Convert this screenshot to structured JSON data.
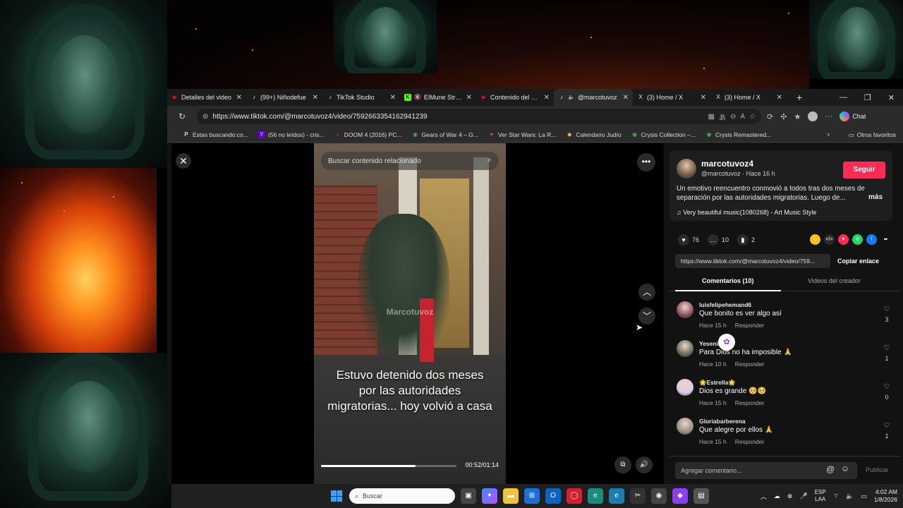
{
  "browser": {
    "tabs": [
      {
        "label": "Detalles del video",
        "icon": "youtube-icon",
        "color": "#ff0000",
        "active": false
      },
      {
        "label": "(99+) Niñodefue",
        "icon": "tiktok-icon",
        "color": "#ffffff",
        "active": false
      },
      {
        "label": "TikTok Studio",
        "icon": "tiktok-icon",
        "color": "#ffffff",
        "active": false
      },
      {
        "label": "ElMune Stream",
        "icon": "kick-icon",
        "color": "#53fc18",
        "active": false
      },
      {
        "label": "Contenido del cana",
        "icon": "youtube-icon",
        "color": "#ff0000",
        "active": false
      },
      {
        "label": "@marcotuvoz",
        "icon": "tiktok-icon",
        "color": "#ffffff",
        "active": true
      },
      {
        "label": "(3) Home / X",
        "icon": "x-icon",
        "color": "#ffffff",
        "active": false
      },
      {
        "label": "(3) Home / X",
        "icon": "x-icon",
        "color": "#ffffff",
        "active": false
      }
    ],
    "url": "https://www.tiktok.com/@marcotuvoz4/video/7592663354162941239",
    "chat_label": "Chat",
    "bookmarks": [
      {
        "label": "Estas buscando:co...",
        "icon": "P"
      },
      {
        "label": "(56 no leídos) - cris...",
        "icon": "Y"
      },
      {
        "label": "DOOM 4 (2016) PC...",
        "icon": "↓"
      },
      {
        "label": "Gears of War 4 – G...",
        "icon": "🎮"
      },
      {
        "label": "Ver Star Wars: La R...",
        "icon": "★"
      },
      {
        "label": "Calendario Judío",
        "icon": "◆"
      },
      {
        "label": "Crysis Collection –...",
        "icon": "🎮"
      },
      {
        "label": "Crysis Remastered...",
        "icon": "🎮"
      }
    ],
    "other_bookmarks": "Otros favoritos"
  },
  "video": {
    "search_placeholder": "Buscar contenido relacionado",
    "watermark": "Marcotuvoz",
    "caption": "Estuvo detenido dos meses por las autoridades migratorias... hoy volvió a casa",
    "time": "00:52/01:14",
    "progress": 0.7
  },
  "post": {
    "username": "marcotuvoz4",
    "handle": "@marcotuvoz · Hace 16 h",
    "follow_label": "Seguir",
    "description": "Un emotivo reencuentro conmovió a todos tras dos meses de separación por las autoridades migratorias. Luego de...",
    "more_label": "más",
    "music": "♫  Very beautiful music(1080268) - Art Music Style",
    "likes": "76",
    "comments": "10",
    "saves": "2",
    "link": "https://www.tiktok.com/@marcotuvoz4/video/759...",
    "copy_label": "Copiar enlace",
    "tab_comments": "Comentarios (10)",
    "tab_creator": "Videos del creador"
  },
  "comments": [
    {
      "user": "luisfelipehemand6",
      "text": "Que bonito es ver algo así",
      "time": "Hace 15 h",
      "reply": "Responder",
      "likes": "3",
      "avatar_color": "#8a4e5c"
    },
    {
      "user": "Yesenia sv",
      "text": "Para Dios no ha imposible 🙏",
      "time": "Hace 10 h",
      "reply": "Responder",
      "likes": "1",
      "avatar_color": "#6b6b5a"
    },
    {
      "user": "🌟Estrella🌟",
      "text": "Dios es grande 🥺🥺",
      "time": "Hace 15 h",
      "reply": "Responder",
      "likes": "0",
      "avatar_color": "#d9c9e6"
    },
    {
      "user": "Gloriabarberena",
      "text": "Que alegre por ellos 🙏",
      "time": "Hace 15 h",
      "reply": "Responder",
      "likes": "1",
      "avatar_color": "#9a8e86"
    }
  ],
  "add_comment": {
    "placeholder": "Agregar comentario...",
    "publish_label": "Publicar"
  },
  "taskbar": {
    "search_placeholder": "Buscar",
    "lang": "ESP",
    "lang2": "LAA",
    "time": "4:02 AM",
    "date": "1/8/2026"
  }
}
